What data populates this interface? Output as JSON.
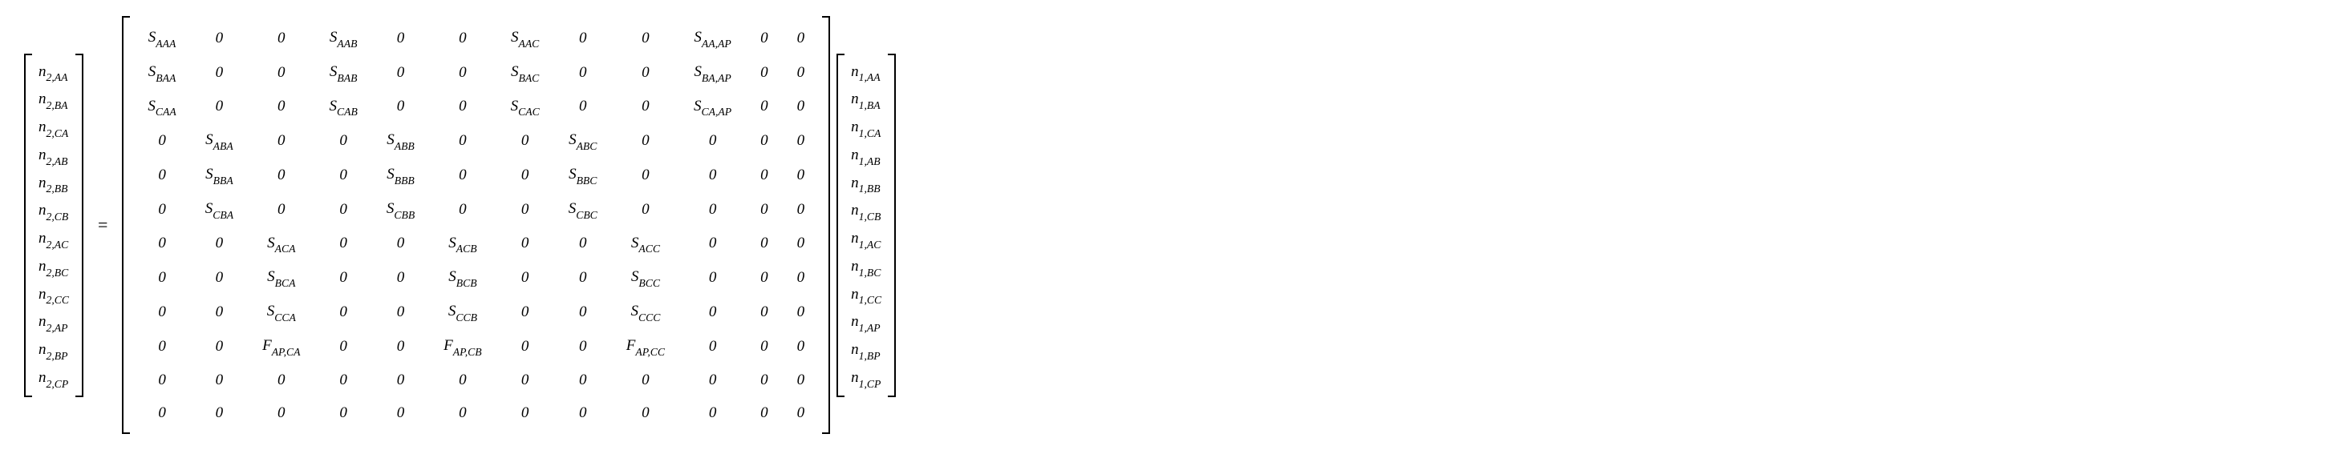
{
  "equals": "=",
  "lhs": [
    "n<sub class='sub'>2,AA</sub>",
    "n<sub class='sub'>2,BA</sub>",
    "n<sub class='sub'>2,CA</sub>",
    "n<sub class='sub'>2,AB</sub>",
    "n<sub class='sub'>2,BB</sub>",
    "n<sub class='sub'>2,CB</sub>",
    "n<sub class='sub'>2,AC</sub>",
    "n<sub class='sub'>2,BC</sub>",
    "n<sub class='sub'>2,CC</sub>",
    "n<sub class='sub'>2,AP</sub>",
    "n<sub class='sub'>2,BP</sub>",
    "n<sub class='sub'>2,CP</sub>"
  ],
  "rhs": [
    "n<sub class='sub'>1,AA</sub>",
    "n<sub class='sub'>1,BA</sub>",
    "n<sub class='sub'>1,CA</sub>",
    "n<sub class='sub'>1,AB</sub>",
    "n<sub class='sub'>1,BB</sub>",
    "n<sub class='sub'>1,CB</sub>",
    "n<sub class='sub'>1,AC</sub>",
    "n<sub class='sub'>1,BC</sub>",
    "n<sub class='sub'>1,CC</sub>",
    "n<sub class='sub'>1,AP</sub>",
    "n<sub class='sub'>1,BP</sub>",
    "n<sub class='sub'>1,CP</sub>"
  ],
  "matrix": [
    [
      "S<sub class='sub'>AAA</sub>",
      "0",
      "0",
      "S<sub class='sub'>AAB</sub>",
      "0",
      "0",
      "S<sub class='sub'>AAC</sub>",
      "0",
      "0",
      "S<sub class='sub'>AA,AP</sub>",
      "0",
      "0"
    ],
    [
      "S<sub class='sub'>BAA</sub>",
      "0",
      "0",
      "S<sub class='sub'>BAB</sub>",
      "0",
      "0",
      "S<sub class='sub'>BAC</sub>",
      "0",
      "0",
      "S<sub class='sub'>BA,AP</sub>",
      "0",
      "0"
    ],
    [
      "S<sub class='sub'>CAA</sub>",
      "0",
      "0",
      "S<sub class='sub'>CAB</sub>",
      "0",
      "0",
      "S<sub class='sub'>CAC</sub>",
      "0",
      "0",
      "S<sub class='sub'>CA,AP</sub>",
      "0",
      "0"
    ],
    [
      "0",
      "S<sub class='sub'>ABA</sub>",
      "0",
      "0",
      "S<sub class='sub'>ABB</sub>",
      "0",
      "0",
      "S<sub class='sub'>ABC</sub>",
      "0",
      "0",
      "0",
      "0"
    ],
    [
      "0",
      "S<sub class='sub'>BBA</sub>",
      "0",
      "0",
      "S<sub class='sub'>BBB</sub>",
      "0",
      "0",
      "S<sub class='sub'>BBC</sub>",
      "0",
      "0",
      "0",
      "0"
    ],
    [
      "0",
      "S<sub class='sub'>CBA</sub>",
      "0",
      "0",
      "S<sub class='sub'>CBB</sub>",
      "0",
      "0",
      "S<sub class='sub'>CBC</sub>",
      "0",
      "0",
      "0",
      "0"
    ],
    [
      "0",
      "0",
      "S<sub class='sub'>ACA</sub>",
      "0",
      "0",
      "S<sub class='sub'>ACB</sub>",
      "0",
      "0",
      "S<sub class='sub'>ACC</sub>",
      "0",
      "0",
      "0"
    ],
    [
      "0",
      "0",
      "S<sub class='sub'>BCA</sub>",
      "0",
      "0",
      "S<sub class='sub'>BCB</sub>",
      "0",
      "0",
      "S<sub class='sub'>BCC</sub>",
      "0",
      "0",
      "0"
    ],
    [
      "0",
      "0",
      "S<sub class='sub'>CCA</sub>",
      "0",
      "0",
      "S<sub class='sub'>CCB</sub>",
      "0",
      "0",
      "S<sub class='sub'>CCC</sub>",
      "0",
      "0",
      "0"
    ],
    [
      "0",
      "0",
      "F<sub class='sub'>AP,CA</sub>",
      "0",
      "0",
      "F<sub class='sub'>AP,CB</sub>",
      "0",
      "0",
      "F<sub class='sub'>AP,CC</sub>",
      "0",
      "0",
      "0"
    ],
    [
      "0",
      "0",
      "0",
      "0",
      "0",
      "0",
      "0",
      "0",
      "0",
      "0",
      "0",
      "0"
    ],
    [
      "0",
      "0",
      "0",
      "0",
      "0",
      "0",
      "0",
      "0",
      "0",
      "0",
      "0",
      "0"
    ]
  ]
}
